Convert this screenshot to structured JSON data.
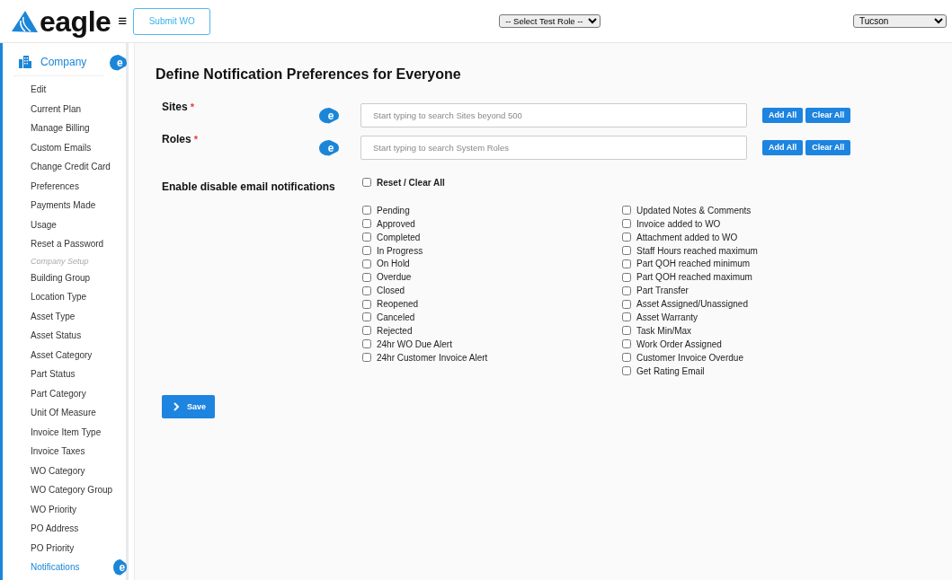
{
  "header": {
    "logo": "eagle",
    "menu_glyph": "≡",
    "submit_button": "Submit WO",
    "role_select": "-- Select Test Role --",
    "site_select": "Tucson"
  },
  "sidebar": {
    "section": {
      "label": "Company",
      "hint": "e"
    },
    "items": [
      {
        "kind": "link",
        "label": "Edit",
        "selected": false
      },
      {
        "kind": "link",
        "label": "Current Plan",
        "selected": false
      },
      {
        "kind": "link",
        "label": "Manage Billing",
        "selected": false
      },
      {
        "kind": "link",
        "label": "Custom Emails",
        "selected": false
      },
      {
        "kind": "link",
        "label": "Change Credit Card",
        "selected": false
      },
      {
        "kind": "link",
        "label": "Preferences",
        "selected": false
      },
      {
        "kind": "link",
        "label": "Payments Made",
        "selected": false
      },
      {
        "kind": "link",
        "label": "Usage",
        "selected": false
      },
      {
        "kind": "link",
        "label": "Reset a Password",
        "selected": false
      },
      {
        "kind": "heading",
        "label": "Company Setup"
      },
      {
        "kind": "link",
        "label": "Building Group",
        "selected": false
      },
      {
        "kind": "link",
        "label": "Location Type",
        "selected": false
      },
      {
        "kind": "link",
        "label": "Asset Type",
        "selected": false
      },
      {
        "kind": "link",
        "label": "Asset Status",
        "selected": false
      },
      {
        "kind": "link",
        "label": "Asset Category",
        "selected": false
      },
      {
        "kind": "link",
        "label": "Part Status",
        "selected": false
      },
      {
        "kind": "link",
        "label": "Part Category",
        "selected": false
      },
      {
        "kind": "link",
        "label": "Unit Of Measure",
        "selected": false
      },
      {
        "kind": "link",
        "label": "Invoice Item Type",
        "selected": false
      },
      {
        "kind": "link",
        "label": "Invoice Taxes",
        "selected": false
      },
      {
        "kind": "link",
        "label": "WO Category",
        "selected": false
      },
      {
        "kind": "link",
        "label": "WO Category Group",
        "selected": false
      },
      {
        "kind": "link",
        "label": "WO Priority",
        "selected": false
      },
      {
        "kind": "link",
        "label": "PO Address",
        "selected": false
      },
      {
        "kind": "link",
        "label": "PO Priority",
        "selected": false
      },
      {
        "kind": "link",
        "label": "Notifications",
        "selected": true,
        "hint": "e"
      }
    ]
  },
  "page": {
    "title": "Define Notification Preferences for Everyone",
    "fields": [
      {
        "label": "Sites",
        "required_mark": "*",
        "hint": "e",
        "placeholder": "Start typing to search Sites beyond 500",
        "add_button": "Add All",
        "clear_button": "Clear All"
      },
      {
        "label": "Roles",
        "required_mark": "*",
        "hint": "e",
        "placeholder": "Start typing to search System Roles",
        "add_button": "Add All",
        "clear_button": "Clear All"
      }
    ],
    "notifications_label": "Enable disable email notifications",
    "reset": {
      "label": "Reset / Clear All",
      "checked": false
    },
    "left_options": [
      {
        "label": "Pending",
        "checked": false
      },
      {
        "label": "Approved",
        "checked": false
      },
      {
        "label": "Completed",
        "checked": false
      },
      {
        "label": "In Progress",
        "checked": false
      },
      {
        "label": "On Hold",
        "checked": false
      },
      {
        "label": "Overdue",
        "checked": false
      },
      {
        "label": "Closed",
        "checked": false
      },
      {
        "label": "Reopened",
        "checked": false
      },
      {
        "label": "Canceled",
        "checked": false
      },
      {
        "label": "Rejected",
        "checked": false
      },
      {
        "label": "24hr WO Due Alert",
        "checked": false
      },
      {
        "label": "24hr Customer Invoice Alert",
        "checked": false
      }
    ],
    "right_options": [
      {
        "label": "Updated Notes & Comments",
        "checked": false
      },
      {
        "label": "Invoice added to WO",
        "checked": false
      },
      {
        "label": "Attachment added to WO",
        "checked": false
      },
      {
        "label": "Staff Hours reached maximum",
        "checked": false
      },
      {
        "label": "Part QOH reached minimum",
        "checked": false
      },
      {
        "label": "Part QOH reached maximum",
        "checked": false
      },
      {
        "label": "Part Transfer",
        "checked": false
      },
      {
        "label": "Asset Assigned/Unassigned",
        "checked": false
      },
      {
        "label": "Asset Warranty",
        "checked": false
      },
      {
        "label": "Task Min/Max",
        "checked": false
      },
      {
        "label": "Work Order Assigned",
        "checked": false
      },
      {
        "label": "Customer Invoice Overdue",
        "checked": false
      },
      {
        "label": "Get Rating Email",
        "checked": false
      }
    ],
    "save_button": "Save"
  }
}
